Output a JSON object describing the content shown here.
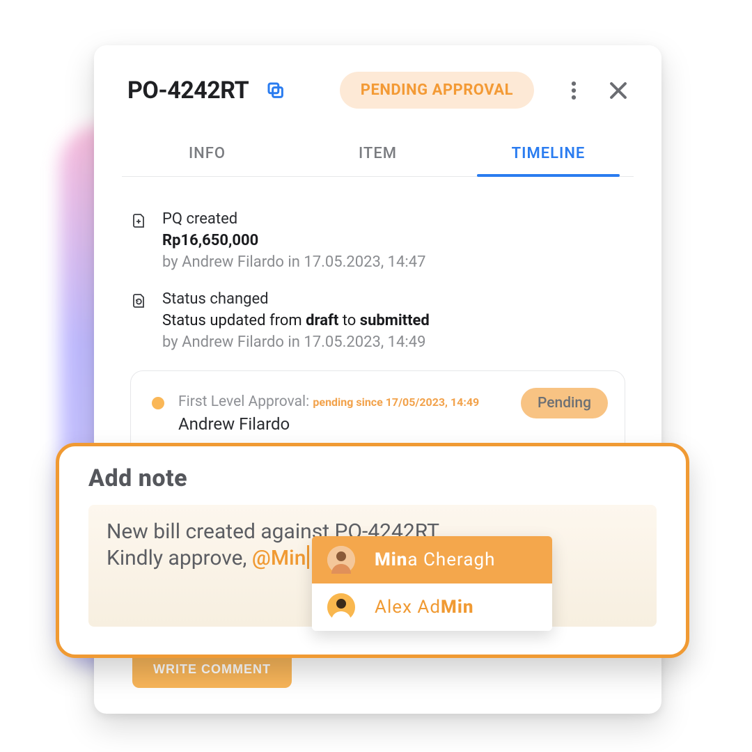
{
  "header": {
    "title": "PO-4242RT",
    "status": "PENDING APPROVAL"
  },
  "tabs": {
    "info": "INFO",
    "item": "ITEM",
    "timeline": "TIMELINE"
  },
  "timeline": {
    "created": {
      "title": "PQ created",
      "amount": "Rp16,650,000",
      "by": "by Andrew Filardo in 17.05.2023, 14:47"
    },
    "status": {
      "title": "Status changed",
      "line_pre": "Status updated from ",
      "from": "draft",
      "line_mid": " to ",
      "to": "submitted",
      "by": "by Andrew Filardo in 17.05.2023, 14:49"
    }
  },
  "approval": {
    "label": "First Level Approval: ",
    "since": "pending since 17/05/2023, 14:49",
    "name": "Andrew Filardo",
    "pill": "Pending"
  },
  "comment_btn": "WRITE COMMENT",
  "note": {
    "title": "Add note",
    "l1": "New bill created against PO-4242RT.",
    "l2a": "Kindly approve, ",
    "l2m": "@Min"
  },
  "suggest": {
    "s1a": "Min",
    "s1b": "a Cheragh",
    "s2a": "Alex Ad",
    "s2b": "Min"
  }
}
